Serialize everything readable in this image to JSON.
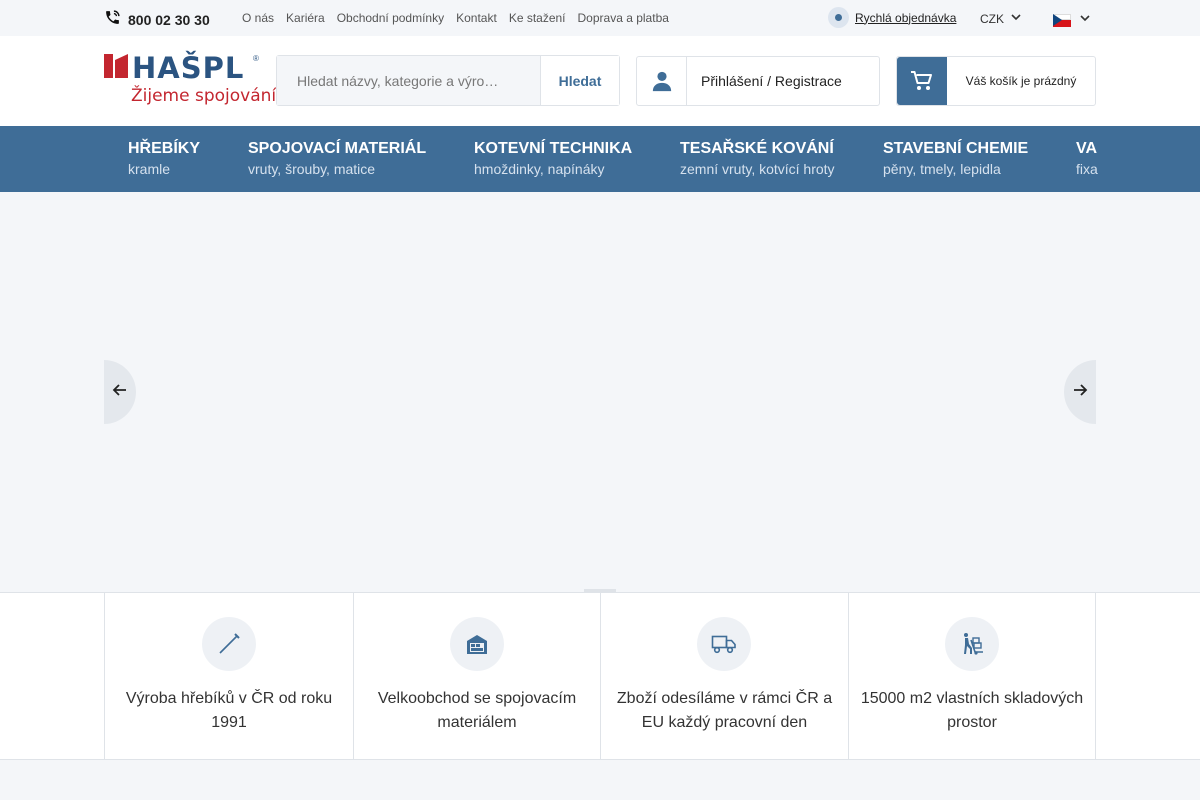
{
  "topbar": {
    "phone": "800 02 30 30",
    "links": [
      "O nás",
      "Kariéra",
      "Obchodní podmínky",
      "Kontakt",
      "Ke stažení",
      "Doprava a platba"
    ],
    "quick_order": "Rychlá objednávka",
    "currency": "CZK",
    "language_flag": "czech-flag"
  },
  "header": {
    "logo_brand": "HAŠPL",
    "logo_reg": "®",
    "logo_slogan": "Žijeme spojováním",
    "search_placeholder": "Hledat názvy, kategorie a výro…",
    "search_button": "Hledat",
    "login_label": "Přihlášení / Registrace",
    "cart_label": "Váš košík je prázdný"
  },
  "nav": [
    {
      "title": "HŘEBÍKY",
      "sub": "kramle"
    },
    {
      "title": "SPOJOVACÍ MATERIÁL",
      "sub": "vruty, šrouby, matice"
    },
    {
      "title": "KOTEVNÍ TECHNIKA",
      "sub": "hmoždinky, napínáky"
    },
    {
      "title": "TESAŘSKÉ KOVÁNÍ",
      "sub": "zemní vruty, kotvící hroty"
    },
    {
      "title": "STAVEBNÍ CHEMIE",
      "sub": "pěny, tmely, lepidla"
    },
    {
      "title": "VA",
      "sub": "fixa"
    }
  ],
  "features": [
    {
      "icon": "nail-icon",
      "text": "Výroba hřebíků v ČR od roku 1991"
    },
    {
      "icon": "warehouse-icon",
      "text": "Velkoobchod se spojovacím materiálem"
    },
    {
      "icon": "truck-icon",
      "text": "Zboží odesíláme v rámci ČR a EU každý pracovní den"
    },
    {
      "icon": "handcart-icon",
      "text": "15000 m2 vlastních skladových prostor"
    }
  ],
  "colors": {
    "primary": "#3f6d97",
    "brand_red": "#c3262f",
    "light_bg": "#f4f6f9",
    "border": "#dfe3e8"
  }
}
